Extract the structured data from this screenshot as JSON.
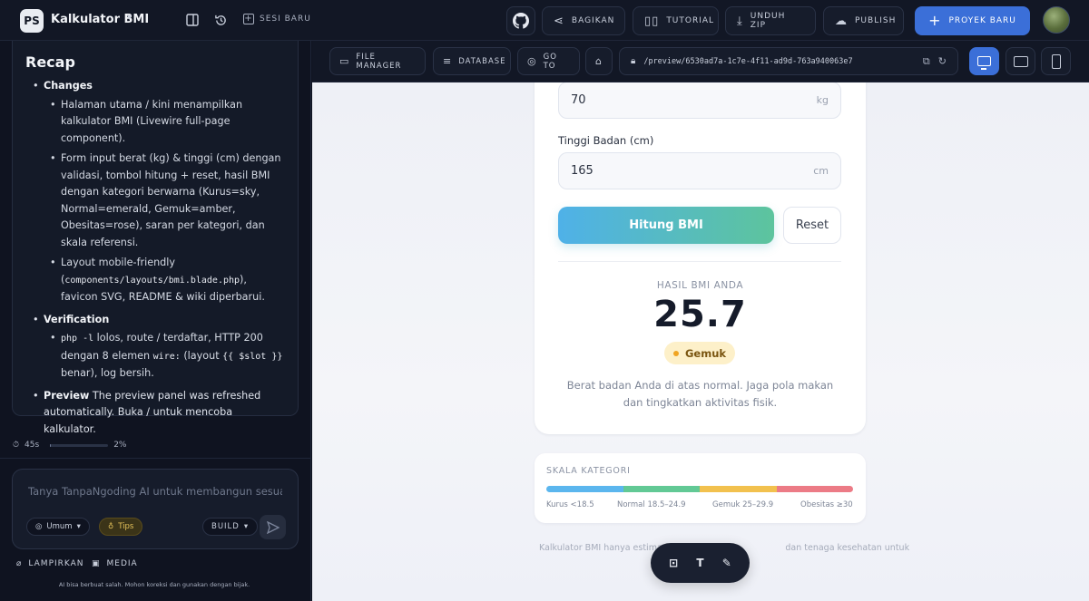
{
  "topbar": {
    "logo": "PS",
    "project_title": "Kalkulator BMI",
    "sesi_baru": "SESI BARU",
    "bagikan": "BAGIKAN",
    "tutorial": "TUTORIAL",
    "unduh_zip": "UNDUH ZIP",
    "publish": "PUBLISH",
    "proyek_baru": "PROYEK BARU"
  },
  "recap": {
    "title": "Recap",
    "changes_label": "Changes",
    "changes": [
      "Halaman utama / kini menampilkan kalkulator BMI (Livewire full-page component).",
      "Form input berat (kg) & tinggi (cm) dengan validasi, tombol hitung + reset, hasil BMI dengan kategori berwarna (Kurus=sky, Normal=emerald, Gemuk=amber, Obesitas=rose), saran per kategori, dan skala referensi."
    ],
    "layout_pre": "Layout mobile-friendly (",
    "layout_code": "components/layouts/bmi.blade.php",
    "layout_post": "), favicon SVG, README & wiki diperbarui.",
    "verification_label": "Verification",
    "verif_code1": "php -l",
    "verif_text1": " lolos, route / terdaftar, HTTP 200 dengan 8 elemen ",
    "verif_code2": "wire:",
    "verif_text2": " (layout ",
    "verif_code3": "{{ $slot }}",
    "verif_text3": " benar), log bersih.",
    "preview_label": "Preview",
    "preview_text": " The preview panel was refreshed automatically. Buka / untuk mencoba kalkulator."
  },
  "status": {
    "time": "45s",
    "percent": "2%",
    "progress_fraction": 0.02
  },
  "composer": {
    "placeholder": "Tanya TanpaNgoding AI untuk membangun sesuatu...",
    "mode": "Umum",
    "tips": "Tips",
    "build": "BUILD"
  },
  "attachments": {
    "lampirkan": "LAMPIRKAN",
    "media": "MEDIA"
  },
  "disclaimer": "AI bisa berbuat salah. Mohon koreksi dan gunakan dengan bijak.",
  "preview_toolbar": {
    "file_manager": "FILE MANAGER",
    "database": "DATABASE",
    "go_to": "GO TO",
    "url": "/preview/6530ad7a-1c7e-4f11-ad9d-763a940063e7"
  },
  "bmi": {
    "weight_value": "70",
    "weight_unit": "kg",
    "height_label": "Tinggi Badan (cm)",
    "height_value": "165",
    "height_unit": "cm",
    "hitung": "Hitung BMI",
    "reset": "Reset",
    "result_label": "HASIL BMI ANDA",
    "result_value": "25.7",
    "category": "Gemuk",
    "advice": "Berat badan Anda di atas normal. Jaga pola makan dan tingkatkan aktivitas fisik."
  },
  "scale": {
    "title": "SKALA KATEGORI",
    "kurus": "Kurus <18.5",
    "normal": "Normal 18.5–24.9",
    "gemuk": "Gemuk 25–29.9",
    "obesitas": "Obesitas ≥30",
    "colors": [
      "#5bb6ee",
      "#62c995",
      "#f2c14e",
      "#ec7b86"
    ]
  },
  "footnote": "Kalkulator BMI hanya estimasi",
  "footnote_end": "dan tenaga kesehatan untuk"
}
